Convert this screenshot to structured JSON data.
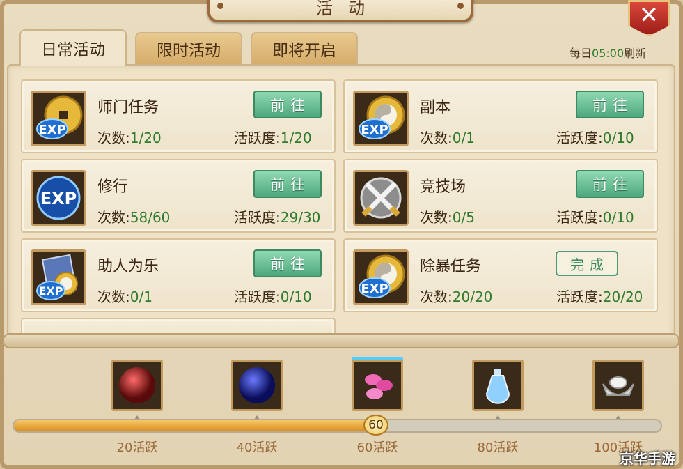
{
  "window": {
    "title": "活动"
  },
  "tabs": [
    {
      "label": "日常活动",
      "active": true
    },
    {
      "label": "限时活动",
      "active": false
    },
    {
      "label": "即将开启",
      "active": false
    }
  ],
  "refresh": {
    "prefix": "每日",
    "time": "05:00",
    "suffix": "刷新"
  },
  "labels": {
    "count": "次数:",
    "activity": "活跃度:",
    "go": "前往",
    "done": "完成"
  },
  "activities": [
    {
      "name": "师门任务",
      "count": "1/20",
      "activity": "1/20",
      "icon": "exp-coin-icon",
      "action": "前往"
    },
    {
      "name": "副本",
      "count": "0/1",
      "activity": "0/10",
      "icon": "exp-taiji-icon",
      "action": "前往"
    },
    {
      "name": "修行",
      "count": "58/60",
      "activity": "29/30",
      "icon": "exp-icon",
      "action": "前往"
    },
    {
      "name": "竞技场",
      "count": "0/5",
      "activity": "0/10",
      "icon": "crossed-swords-icon",
      "action": "前往"
    },
    {
      "name": "助人为乐",
      "count": "0/1",
      "activity": "0/10",
      "icon": "exp-book-icon",
      "action": "前往"
    },
    {
      "name": "除暴任务",
      "count": "20/20",
      "activity": "20/20",
      "icon": "exp-taiji-icon",
      "action": "完成"
    }
  ],
  "rewards": [
    {
      "milestone": "20活跃",
      "icon": "red-orb-icon"
    },
    {
      "milestone": "40活跃",
      "icon": "blue-orb-icon"
    },
    {
      "milestone": "60活跃",
      "icon": "pink-gems-icon"
    },
    {
      "milestone": "80活跃",
      "icon": "potion-bottle-icon"
    },
    {
      "milestone": "100活跃",
      "icon": "silver-ingot-icon"
    }
  ],
  "progress": {
    "value": 60,
    "max": 100,
    "label": "60"
  },
  "watermark": "京华手游",
  "colors": {
    "accent_green": "#2f7a2c",
    "button_green": "#4ea87d",
    "close_red": "#c0342a",
    "progress_orange": "#e8a336"
  }
}
